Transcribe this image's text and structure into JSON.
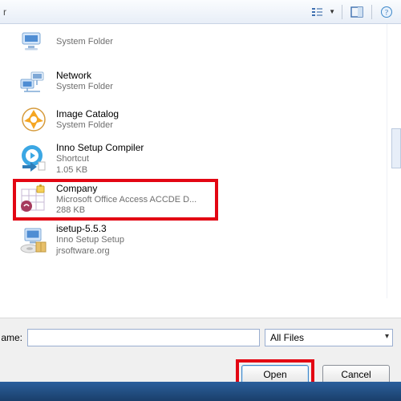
{
  "toolbar": {
    "left_text": "r"
  },
  "items": [
    {
      "name": "",
      "line1": "System Folder",
      "line2": ""
    },
    {
      "name": "Network",
      "line1": "System Folder",
      "line2": ""
    },
    {
      "name": "Image Catalog",
      "line1": "System Folder",
      "line2": ""
    },
    {
      "name": "Inno Setup Compiler",
      "line1": "Shortcut",
      "line2": "1.05 KB"
    },
    {
      "name": "Company",
      "line1": "Microsoft Office Access ACCDE D...",
      "line2": "288 KB"
    },
    {
      "name": "isetup-5.5.3",
      "line1": "Inno Setup Setup",
      "line2": "jrsoftware.org"
    }
  ],
  "filebar": {
    "label": "ame:",
    "filename": "",
    "filetype_selected": "All Files"
  },
  "buttons": {
    "open": "Open",
    "cancel": "Cancel"
  }
}
